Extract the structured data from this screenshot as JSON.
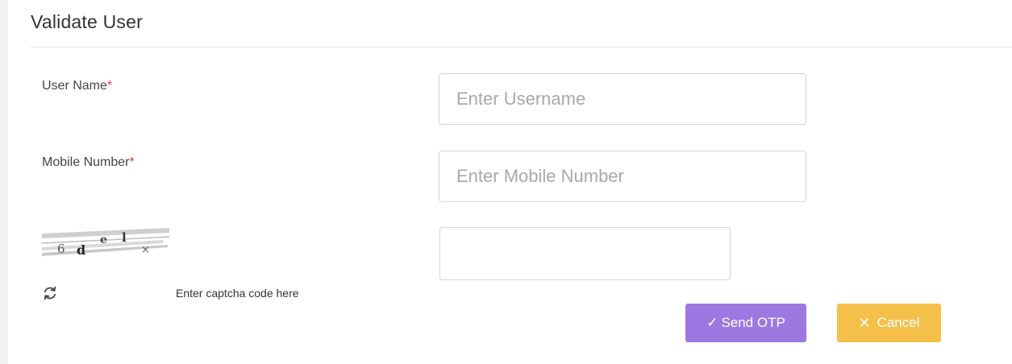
{
  "form": {
    "title": "Validate User",
    "username": {
      "label": "User Name",
      "required_mark": "*",
      "placeholder": "Enter Username",
      "value": ""
    },
    "mobile": {
      "label": "Mobile Number",
      "required_mark": "*",
      "placeholder": "Enter Mobile Number",
      "value": ""
    },
    "captcha": {
      "chars": [
        "6",
        "d",
        "e",
        "l",
        "×"
      ],
      "refresh_icon": "refresh-icon",
      "hint": "Enter captcha code here",
      "value": ""
    },
    "actions": {
      "send_otp": {
        "icon": "✓",
        "label": "Send OTP"
      },
      "cancel": {
        "icon": "✕",
        "label": "Cancel"
      }
    }
  },
  "colors": {
    "send_otp_bg": "#9d78e0",
    "cancel_bg": "#f5c04a",
    "required": "#e53935"
  }
}
